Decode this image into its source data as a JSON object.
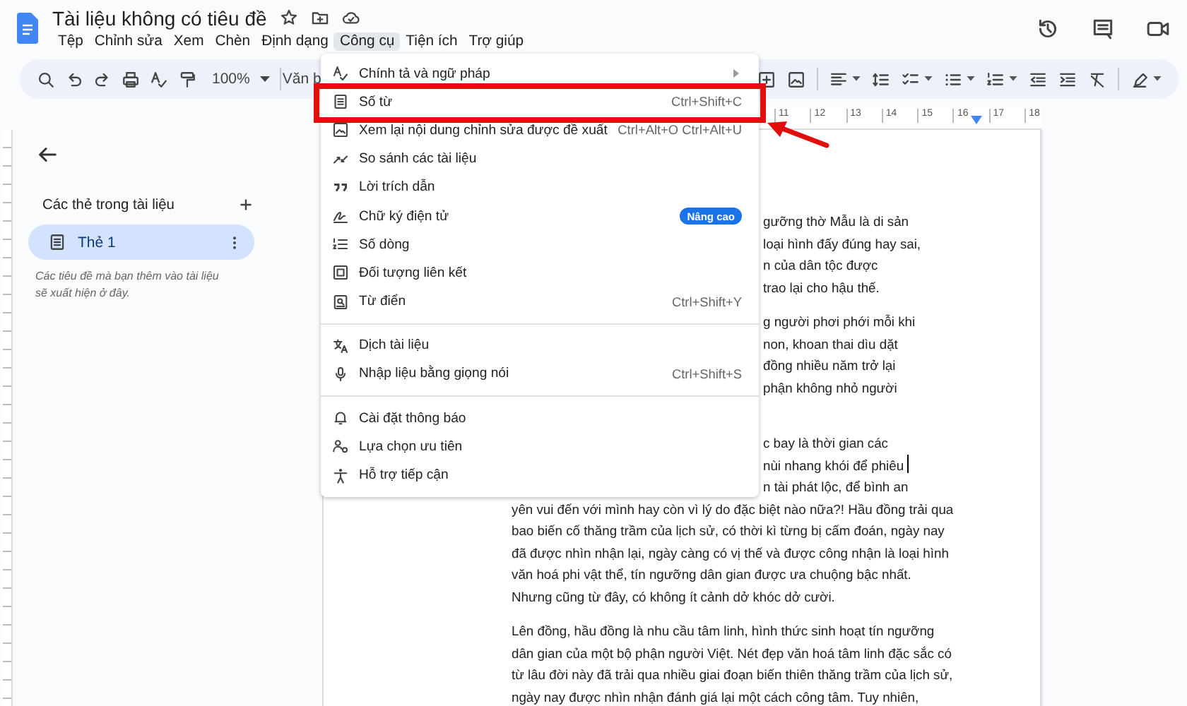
{
  "header": {
    "title": "Tài liệu không có tiêu đề",
    "menubar": [
      {
        "label": "Tệp",
        "selected": false
      },
      {
        "label": "Chỉnh sửa",
        "selected": false
      },
      {
        "label": "Xem",
        "selected": false
      },
      {
        "label": "Chèn",
        "selected": false
      },
      {
        "label": "Định dạng",
        "selected": false
      },
      {
        "label": "Công cụ",
        "selected": true
      },
      {
        "label": "Tiện ích",
        "selected": false
      },
      {
        "label": "Trợ giúp",
        "selected": false
      }
    ]
  },
  "toolbar": {
    "zoom": "100%",
    "style": "Văn b"
  },
  "ruler": [
    "11",
    "12",
    "13",
    "14",
    "15",
    "16",
    "17",
    "18"
  ],
  "sidebar": {
    "heading": "Các thẻ trong tài liệu",
    "tabs": [
      {
        "label": "Thẻ 1",
        "selected": true
      }
    ],
    "hint": "Các tiêu đề mà bạn thêm vào tài liệu sẽ xuất hiện ở đây."
  },
  "menu": {
    "groups": [
      [
        {
          "label": "Chính tả và ngữ pháp",
          "submenu": true,
          "highlighted": false
        },
        {
          "label": "Số từ",
          "shortcut": "Ctrl+Shift+C",
          "highlighted": true
        },
        {
          "label": "Xem lại nội dung chỉnh sửa được đề xuất",
          "shortcut": "Ctrl+Alt+O Ctrl+Alt+U",
          "highlighted": false
        },
        {
          "label": "So sánh các tài liệu",
          "highlighted": false
        },
        {
          "label": "Lời trích dẫn",
          "highlighted": false
        },
        {
          "label": "Chữ ký điện tử",
          "badge": "Nâng cao",
          "highlighted": false
        },
        {
          "label": "Số dòng",
          "highlighted": false
        },
        {
          "label": "Đối tượng liên kết",
          "highlighted": false
        },
        {
          "label": "Từ điển",
          "shortcut": "Ctrl+Shift+Y",
          "highlighted": false
        }
      ],
      [
        {
          "label": "Dịch tài liệu",
          "highlighted": false
        },
        {
          "label": "Nhập liệu bằng giọng nói",
          "shortcut": "Ctrl+Shift+S",
          "highlighted": false
        }
      ],
      [
        {
          "label": "Cài đặt thông báo",
          "highlighted": false
        },
        {
          "label": "Lựa chọn ưu tiên",
          "highlighted": false
        },
        {
          "label": "Hỗ trợ tiếp cận",
          "highlighted": false
        }
      ]
    ]
  },
  "document": {
    "paragraphs": [
      {
        "lines": [
          {
            "text": "gưỡng thờ Mẫu là di sản",
            "kind": "partial"
          },
          {
            "text": "loại hình đấy đúng hay sai,",
            "kind": "partial"
          },
          {
            "text": "n của dân tộc được",
            "kind": "partial"
          },
          {
            "text": "trao lại cho hậu thế.",
            "kind": "partial"
          }
        ]
      },
      {
        "lines": [
          {
            "text": "g người phơi phới mỗi khi",
            "kind": "partial"
          },
          {
            "text": "non, khoan thai dìu dặt",
            "kind": "partial"
          },
          {
            "text": "đồng nhiều năm trở lại",
            "kind": "partial"
          },
          {
            "text": "phận không nhỏ người",
            "kind": "partial"
          }
        ]
      },
      {
        "lines": [
          {
            "text": "c bay là thời gian các",
            "kind": "partial"
          },
          {
            "text": "nùi nhang khói để phiêu",
            "kind": "partial",
            "cursor": true
          },
          {
            "text": "n tài phát lộc, để bình an",
            "kind": "partial"
          },
          {
            "text": "yên vui đến với mình hay còn vì lý do đặc biệt nào nữa?! Hầu đồng trải qua",
            "kind": "full"
          },
          {
            "text": "bao biến cố thăng trầm của lịch sử, có thời kì từng bị cấm đoán, ngày nay",
            "kind": "full"
          },
          {
            "text": "đã được nhìn nhận lại, ngày càng có vị thế và được công nhận là loại hình",
            "kind": "full"
          },
          {
            "text": "văn hoá phi vật thể, tín ngưỡng dân gian được ưa chuộng bậc nhất.",
            "kind": "full"
          },
          {
            "text": "Nhưng cũng từ đây, có không ít cảnh dở khóc dở cười.",
            "kind": "full"
          }
        ]
      },
      {
        "lines": [
          {
            "text": "Lên đồng, hầu đồng là nhu cầu tâm linh, hình thức sinh hoạt tín ngưỡng",
            "kind": "full"
          },
          {
            "text": "dân gian của một bộ phận người Việt. Nét đẹp văn hoá tâm linh đặc sắc có",
            "kind": "full"
          },
          {
            "text": "từ lâu đời này đã trải qua nhiều giai đoạn biến thiên thăng trầm của lịch sử,",
            "kind": "full"
          },
          {
            "text": "ngày nay được nhìn nhận đánh giá lại một cách công tâm. Tuy nhiên,",
            "kind": "full"
          }
        ]
      }
    ]
  }
}
